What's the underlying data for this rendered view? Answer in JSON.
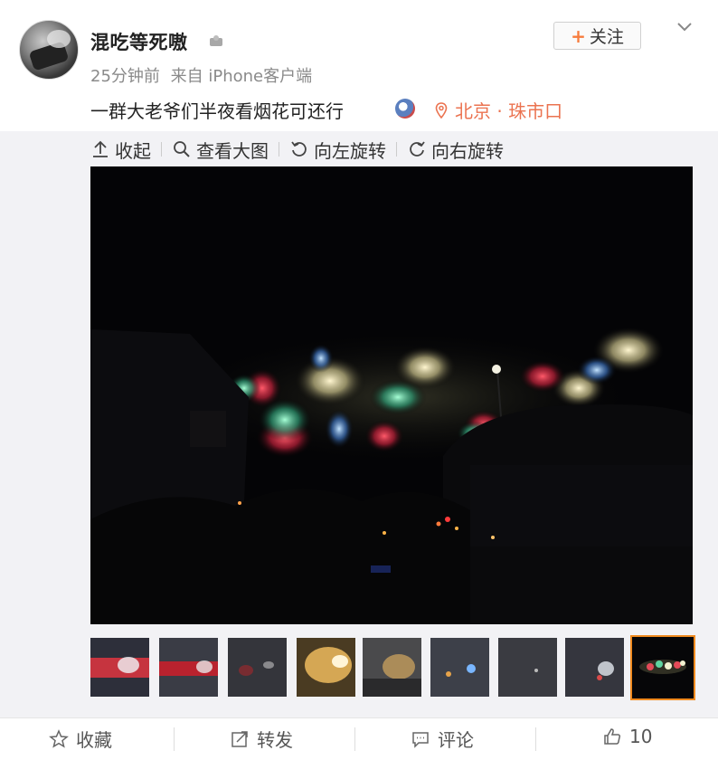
{
  "post": {
    "username": "混吃等死嗷",
    "time": "25分钟前",
    "source": "来自 iPhone客户端",
    "text": "一群大老爷们半夜看烟花可还行",
    "location": "北京 · 珠市口",
    "follow_label": "关注"
  },
  "toolbar": {
    "collapse_label": "收起",
    "view_large_label": "查看大图",
    "rotate_left_label": "向左旋转",
    "rotate_right_label": "向右旋转"
  },
  "thumbnails": {
    "count": 9,
    "selected_index": 9
  },
  "actions": {
    "favorite_label": "收藏",
    "repost_label": "转发",
    "comment_label": "评论",
    "like_count": "10"
  },
  "colors": {
    "accent_orange": "#eb7350",
    "selected_border": "#f08a1f",
    "panel_bg": "#f2f2f5"
  }
}
